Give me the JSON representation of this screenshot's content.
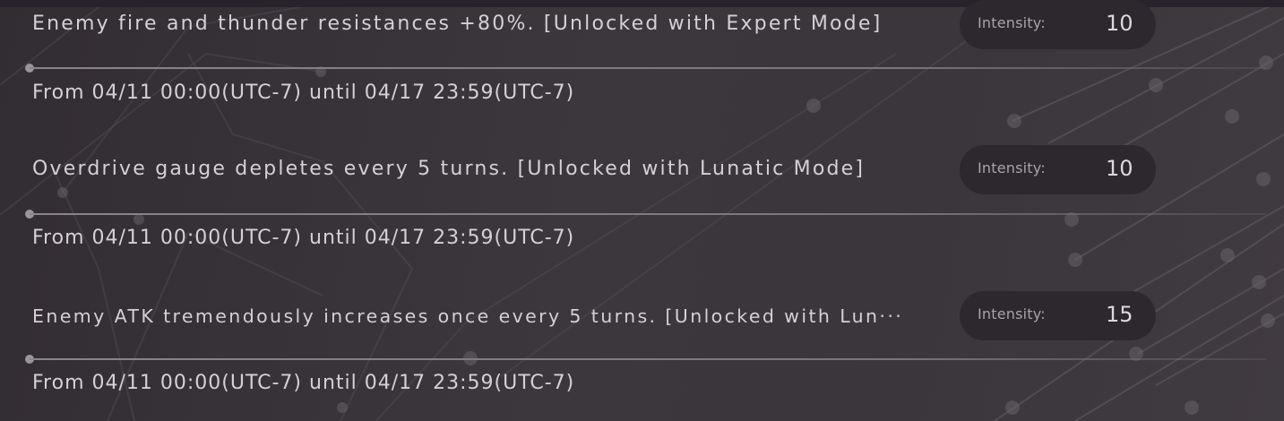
{
  "events": [
    {
      "description": "Enemy fire and thunder resistances +80%. [Unlocked with Expert Mode]",
      "intensity_label": "Intensity:",
      "intensity": "10",
      "period": "From 04/11 00:00(UTC-7) until 04/17 23:59(UTC-7)"
    },
    {
      "description": "Overdrive gauge depletes every 5 turns. [Unlocked with Lunatic Mode]",
      "intensity_label": "Intensity:",
      "intensity": "10",
      "period": "From 04/11 00:00(UTC-7) until 04/17 23:59(UTC-7)"
    },
    {
      "description": "Enemy ATK tremendously increases once every 5 turns. [Unlocked with Lun···",
      "intensity_label": "Intensity:",
      "intensity": "15",
      "period": "From 04/11 00:00(UTC-7) until 04/17 23:59(UTC-7)"
    }
  ]
}
